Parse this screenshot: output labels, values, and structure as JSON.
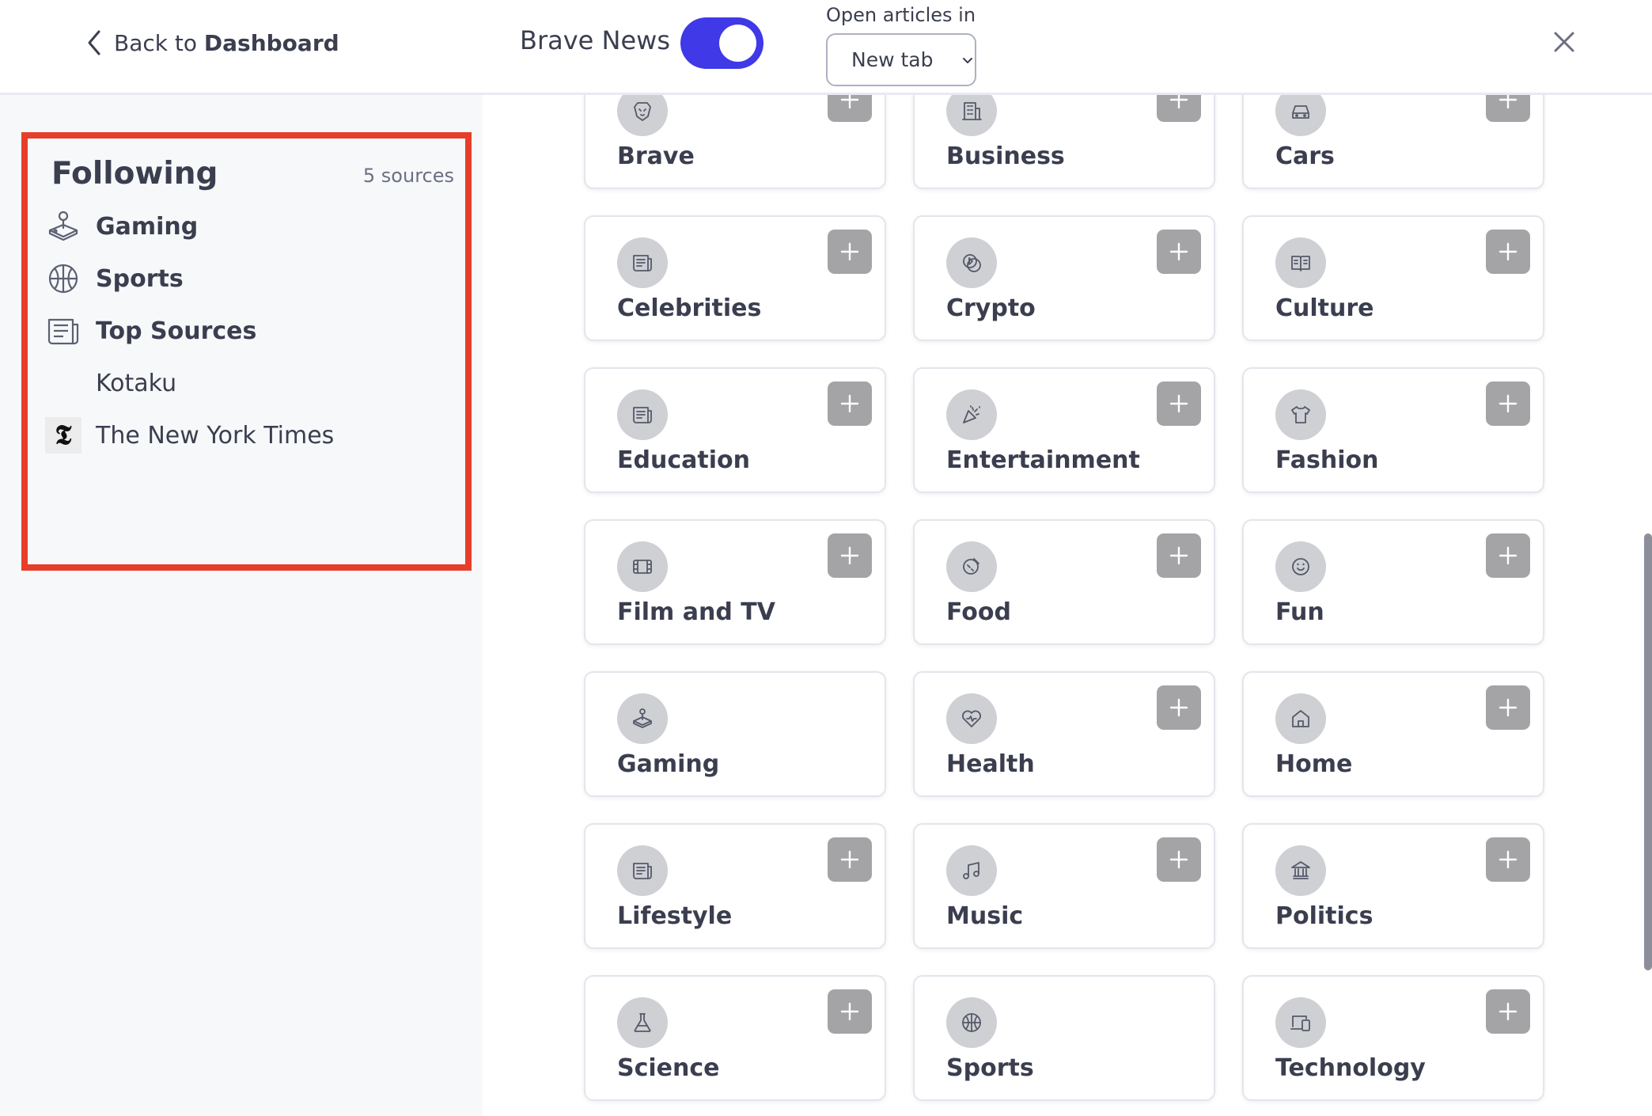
{
  "header": {
    "back_prefix": "Back to",
    "back_bold": "Dashboard",
    "brand_title": "Brave News",
    "toggle_on": true,
    "toggle_color": "#3f39e8",
    "open_articles_label": "Open articles in",
    "open_articles_value": "New tab"
  },
  "following": {
    "title": "Following",
    "count": "5 sources",
    "highlight_color": "#e63e2a",
    "items": [
      {
        "label": "Gaming",
        "icon": "gaming-icon",
        "bold": true
      },
      {
        "label": "Sports",
        "icon": "sports-icon",
        "bold": true
      },
      {
        "label": "Top Sources",
        "icon": "news-icon",
        "bold": true
      },
      {
        "label": "Kotaku",
        "icon": "",
        "bold": false
      },
      {
        "label": "The New York Times",
        "icon": "nyt-logo",
        "bold": false
      }
    ]
  },
  "categories": [
    {
      "label": "Brave",
      "icon": "brave-lion-icon",
      "add": true
    },
    {
      "label": "Business",
      "icon": "building-icon",
      "add": true
    },
    {
      "label": "Cars",
      "icon": "car-icon",
      "add": true
    },
    {
      "label": "Celebrities",
      "icon": "news-icon",
      "add": true
    },
    {
      "label": "Crypto",
      "icon": "crypto-icon",
      "add": true
    },
    {
      "label": "Culture",
      "icon": "book-icon",
      "add": true
    },
    {
      "label": "Education",
      "icon": "news-icon",
      "add": true
    },
    {
      "label": "Entertainment",
      "icon": "party-popper-icon",
      "add": true
    },
    {
      "label": "Fashion",
      "icon": "shirt-icon",
      "add": true
    },
    {
      "label": "Film and TV",
      "icon": "film-icon",
      "add": true
    },
    {
      "label": "Food",
      "icon": "food-icon",
      "add": true
    },
    {
      "label": "Fun",
      "icon": "smiley-icon",
      "add": true
    },
    {
      "label": "Gaming",
      "icon": "gaming-icon",
      "add": false
    },
    {
      "label": "Health",
      "icon": "heart-icon",
      "add": true
    },
    {
      "label": "Home",
      "icon": "house-icon",
      "add": true
    },
    {
      "label": "Lifestyle",
      "icon": "news-icon",
      "add": true
    },
    {
      "label": "Music",
      "icon": "music-note-icon",
      "add": true
    },
    {
      "label": "Politics",
      "icon": "government-icon",
      "add": true
    },
    {
      "label": "Science",
      "icon": "flask-icon",
      "add": true
    },
    {
      "label": "Sports",
      "icon": "sports-icon",
      "add": false
    },
    {
      "label": "Technology",
      "icon": "devices-icon",
      "add": true
    }
  ]
}
